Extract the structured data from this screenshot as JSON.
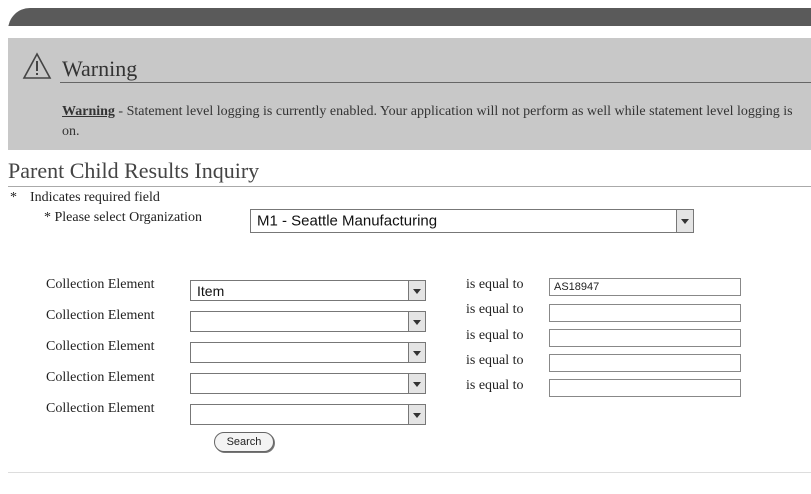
{
  "warning": {
    "title": "Warning",
    "bold_label": "Warning",
    "message": " - Statement level logging is currently enabled. Your application will not perform as well while statement level logging is on."
  },
  "page": {
    "title": "Parent Child Results Inquiry",
    "required_star": "*",
    "required_note": "Indicates required field",
    "org_label": "* Please select Organization",
    "org_value": "M1 - Seattle Manufacturing"
  },
  "criteria": [
    {
      "label": "Collection Element",
      "element": "Item",
      "operator": "is equal to",
      "value": "AS18947"
    },
    {
      "label": "Collection Element",
      "element": "",
      "operator": "is equal to",
      "value": ""
    },
    {
      "label": "Collection Element",
      "element": "",
      "operator": "is equal to",
      "value": ""
    },
    {
      "label": "Collection Element",
      "element": "",
      "operator": "is equal to",
      "value": ""
    },
    {
      "label": "Collection Element",
      "element": "",
      "operator": "is equal to",
      "value": ""
    }
  ],
  "actions": {
    "search_label": "Search"
  }
}
